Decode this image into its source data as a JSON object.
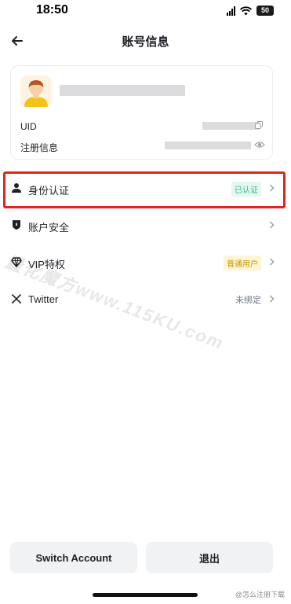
{
  "status_bar": {
    "time": "18:50",
    "battery": "50"
  },
  "nav": {
    "title": "账号信息"
  },
  "profile": {
    "uid_label": "UID",
    "registration_label": "注册信息"
  },
  "menu": {
    "identity": {
      "label": "身份认证",
      "badge": "已认证"
    },
    "security": {
      "label": "账户安全"
    },
    "vip": {
      "label": "VIP特权",
      "badge": "普通用户"
    },
    "twitter": {
      "label": "Twitter",
      "status": "未绑定"
    }
  },
  "watermark": "量化魔方www.115KU.com",
  "buttons": {
    "switch_account": "Switch Account",
    "logout": "退出"
  },
  "source_mark": "@怎么注册下载",
  "colors": {
    "highlight_border": "#e0251b",
    "verified_text": "#2ebd85",
    "verified_bg": "#e6f7ef",
    "vip_text": "#c99400",
    "vip_bg": "#fdf5d6",
    "button_bg": "#f1f2f4"
  },
  "icons": {
    "back": "arrow-left-icon",
    "identity": "person-icon",
    "security": "shield-icon",
    "vip": "diamond-icon",
    "twitter": "x-logo-icon",
    "chevron": "chevron-right-icon",
    "copy": "copy-icon",
    "eye": "eye-icon"
  }
}
